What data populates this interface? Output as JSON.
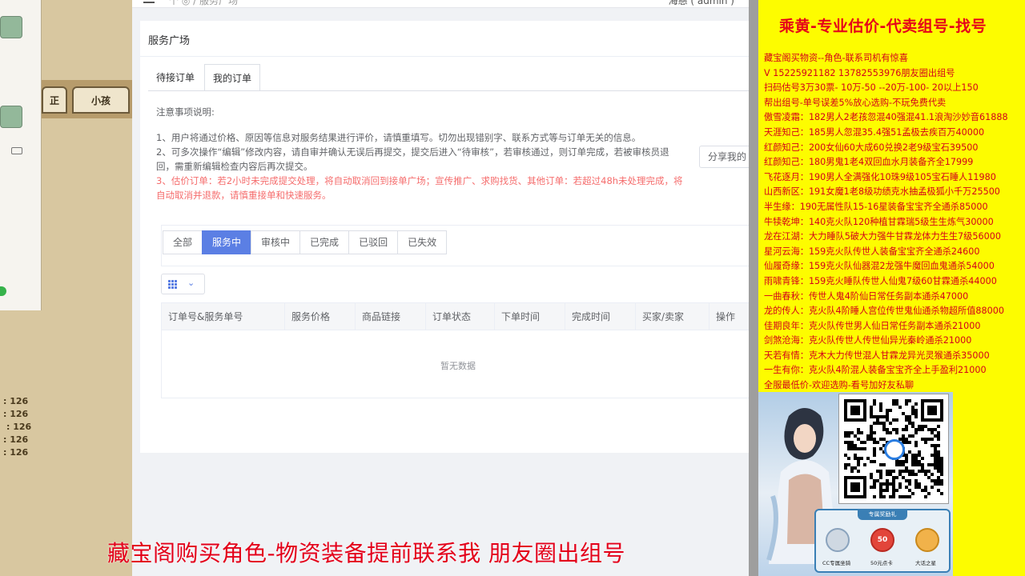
{
  "game_left": {
    "tab_left_label": "正",
    "tab_right_label": "小孩",
    "stats": [
      ": 126",
      ": 126",
      ": 126",
      ": 126",
      ": 126"
    ]
  },
  "web": {
    "topbar": {
      "breadcrumb": "个   ◎  /   服务广场",
      "user": "海慈 ( admin )"
    },
    "page_title": "服务广场",
    "tabs": [
      {
        "label": "待接订单",
        "active": false
      },
      {
        "label": "我的订单",
        "active": true
      }
    ],
    "notice": {
      "heading": "注意事项说明:",
      "item1": "1、用户将通过价格、原因等信息对服务结果进行评价，请慎重填写。切勿出现错别字、联系方式等与订单无关的信息。",
      "item2": "2、可多次操作“编辑”修改内容，请自审并确认无误后再提交，提交后进入“待审核”，若审核通过，则订单完成，若被审核员退回，需重新编辑检查内容后再次提交。",
      "item3": "3、估价订单：若2小时未完成提交处理，将自动取消回到接单广场；宣传推广、求购找货、其他订单：若超过48h未处理完成，将自动取消并退款，请慎重接单和快速服务。"
    },
    "share_button": "分享我的",
    "filters": [
      {
        "label": "全部",
        "active": false
      },
      {
        "label": "服务中",
        "active": true
      },
      {
        "label": "审核中",
        "active": false
      },
      {
        "label": "已完成",
        "active": false
      },
      {
        "label": "已驳回",
        "active": false
      },
      {
        "label": "已失效",
        "active": false
      }
    ],
    "table": {
      "columns": [
        "订单号&服务单号",
        "服务价格",
        "商品链接",
        "订单状态",
        "下单时间",
        "完成时间",
        "买家/卖家",
        "操作"
      ],
      "empty_text": "暂无数据"
    }
  },
  "ad": {
    "title": "乘黄-专业估价-代卖组号-找号",
    "lines": [
      "藏宝阁买物资--角色-联系司机有惊喜",
      "V  15225921182   13782553976朋友圈出组号",
      "扫码估号3万30票- 10万-50 --20万-100- 20以上150",
      "帮出组号-单号误差5%放心选购-不玩免费代卖",
      "傲雪凌霜：182男人2老孩忽混40强混41.1浪淘沙妙音61888",
      "天涯知己：185男人忽混35.4强51孟极去疾百万40000",
      "红颜知己：200女仙60大成60兑换2老9级宝石39500",
      "红颜知己：180男鬼1老4双回血水月装备齐全17999",
      "飞花逐月：190男人全满强化10珠9级105宝石睡人11980",
      "山西新区：191女魔1老8级功绩克水抽孟极狐小千万25500",
      "半生缘：190无属性队15-16星装备宝宝齐全通杀85000",
      "牛犊乾坤：140克火队120种植甘霖瑞5级生生炼气30000",
      "龙在江湖：大力睡队5破大力强牛甘霖龙体力生生7级56000",
      "星河云海：159克火队传世人装备宝宝齐全通杀24600",
      "仙履奇缘：159克火队仙器混2龙强牛魔回血鬼通杀54000",
      "雨啸青锋：159克火睡队传世人仙鬼7级60甘霖通杀44000",
      "一曲春秋：传世人鬼4阶仙日常任务副本通杀47000",
      "龙的传人：克火队4阶睡人宫位传世鬼仙通杀物超所值88000",
      "佳期良年：克火队传世男人仙日常任务副本通杀21000",
      "剑煞沧海：克火队传世人传世仙异光秦岭通杀21000",
      "天若有情：克木大力传世混人甘霖龙异光灵猴通杀35000",
      "一生有你：克火队4阶混人装备宝宝齐全上手盈利21000",
      "全服最低价-欢迎选购-看号加好友私聊"
    ],
    "promo": {
      "ribbon": "专属奖励礼",
      "gift1": "CC专属坐骑",
      "gift2": "50元点卡",
      "gift2_badge": "50",
      "gift3": "大话之星"
    }
  },
  "bottom_banner": "藏宝阁购买角色-物资装备提前联系我      朋友圈出组号",
  "colors": {
    "accent": "#5b7fe4",
    "ad_bg": "#fdfc00",
    "ad_text": "#d4001a",
    "danger": "#f56c6c"
  }
}
